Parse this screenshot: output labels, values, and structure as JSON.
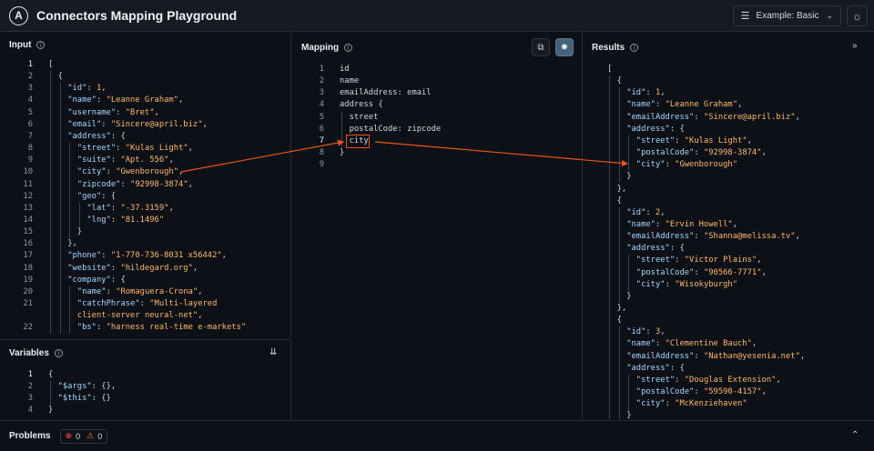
{
  "header": {
    "title": "Connectors Mapping Playground",
    "example_prefix": "Example:",
    "example_value": "Basic"
  },
  "input": {
    "title": "Input",
    "lines": [
      {
        "n": "1",
        "indent": 0,
        "parts": [
          [
            "p",
            "["
          ]
        ]
      },
      {
        "n": "2",
        "indent": 1,
        "parts": [
          [
            "p",
            "{"
          ]
        ]
      },
      {
        "n": "3",
        "indent": 2,
        "parts": [
          [
            "k",
            "\"id\""
          ],
          [
            "p",
            ": "
          ],
          [
            "n",
            "1"
          ],
          [
            "p",
            ","
          ]
        ]
      },
      {
        "n": "4",
        "indent": 2,
        "parts": [
          [
            "k",
            "\"name\""
          ],
          [
            "p",
            ": "
          ],
          [
            "s",
            "\"Leanne Graham\""
          ],
          [
            "p",
            ","
          ]
        ]
      },
      {
        "n": "5",
        "indent": 2,
        "parts": [
          [
            "k",
            "\"username\""
          ],
          [
            "p",
            ": "
          ],
          [
            "s",
            "\"Bret\""
          ],
          [
            "p",
            ","
          ]
        ]
      },
      {
        "n": "6",
        "indent": 2,
        "parts": [
          [
            "k",
            "\"email\""
          ],
          [
            "p",
            ": "
          ],
          [
            "s",
            "\"Sincere@april.biz\""
          ],
          [
            "p",
            ","
          ]
        ]
      },
      {
        "n": "7",
        "indent": 2,
        "parts": [
          [
            "k",
            "\"address\""
          ],
          [
            "p",
            ": {"
          ]
        ]
      },
      {
        "n": "8",
        "indent": 3,
        "parts": [
          [
            "k",
            "\"street\""
          ],
          [
            "p",
            ": "
          ],
          [
            "s",
            "\"Kulas Light\""
          ],
          [
            "p",
            ","
          ]
        ]
      },
      {
        "n": "9",
        "indent": 3,
        "parts": [
          [
            "k",
            "\"suite\""
          ],
          [
            "p",
            ": "
          ],
          [
            "s",
            "\"Apt. 556\""
          ],
          [
            "p",
            ","
          ]
        ]
      },
      {
        "n": "10",
        "indent": 3,
        "parts": [
          [
            "k",
            "\"city\""
          ],
          [
            "p",
            ": "
          ],
          [
            "s",
            "\"Gwenborough\""
          ],
          [
            "p",
            ","
          ]
        ]
      },
      {
        "n": "11",
        "indent": 3,
        "parts": [
          [
            "k",
            "\"zipcode\""
          ],
          [
            "p",
            ": "
          ],
          [
            "s",
            "\"92998-3874\""
          ],
          [
            "p",
            ","
          ]
        ]
      },
      {
        "n": "12",
        "indent": 3,
        "parts": [
          [
            "k",
            "\"geo\""
          ],
          [
            "p",
            ": {"
          ]
        ]
      },
      {
        "n": "13",
        "indent": 4,
        "parts": [
          [
            "k",
            "\"lat\""
          ],
          [
            "p",
            ": "
          ],
          [
            "s",
            "\"-37.3159\""
          ],
          [
            "p",
            ","
          ]
        ]
      },
      {
        "n": "14",
        "indent": 4,
        "parts": [
          [
            "k",
            "\"lng\""
          ],
          [
            "p",
            ": "
          ],
          [
            "s",
            "\"81.1496\""
          ]
        ]
      },
      {
        "n": "15",
        "indent": 3,
        "parts": [
          [
            "p",
            "}"
          ]
        ]
      },
      {
        "n": "16",
        "indent": 2,
        "parts": [
          [
            "p",
            "},"
          ]
        ]
      },
      {
        "n": "17",
        "indent": 2,
        "parts": [
          [
            "k",
            "\"phone\""
          ],
          [
            "p",
            ": "
          ],
          [
            "s",
            "\"1-770-736-8031 x56442\""
          ],
          [
            "p",
            ","
          ]
        ]
      },
      {
        "n": "18",
        "indent": 2,
        "parts": [
          [
            "k",
            "\"website\""
          ],
          [
            "p",
            ": "
          ],
          [
            "s",
            "\"hildegard.org\""
          ],
          [
            "p",
            ","
          ]
        ]
      },
      {
        "n": "19",
        "indent": 2,
        "parts": [
          [
            "k",
            "\"company\""
          ],
          [
            "p",
            ": {"
          ]
        ]
      },
      {
        "n": "20",
        "indent": 3,
        "parts": [
          [
            "k",
            "\"name\""
          ],
          [
            "p",
            ": "
          ],
          [
            "s",
            "\"Romaguera-Crona\""
          ],
          [
            "p",
            ","
          ]
        ]
      },
      {
        "n": "21",
        "indent": 3,
        "parts": [
          [
            "k",
            "\"catchPhrase\""
          ],
          [
            "p",
            ": "
          ],
          [
            "s",
            "\"Multi-layered"
          ]
        ]
      },
      {
        "n": "",
        "indent": 3,
        "parts": [
          [
            "s",
            "client-server neural-net\""
          ],
          [
            "p",
            ","
          ]
        ]
      },
      {
        "n": "22",
        "indent": 3,
        "parts": [
          [
            "k",
            "\"bs\""
          ],
          [
            "p",
            ": "
          ],
          [
            "s",
            "\"harness real-time e-markets\""
          ]
        ]
      }
    ]
  },
  "variables": {
    "title": "Variables",
    "lines": [
      {
        "n": "1",
        "indent": 0,
        "parts": [
          [
            "p",
            "{"
          ]
        ]
      },
      {
        "n": "2",
        "indent": 1,
        "parts": [
          [
            "k",
            "\"$args\""
          ],
          [
            "p",
            ": {},"
          ]
        ]
      },
      {
        "n": "3",
        "indent": 1,
        "parts": [
          [
            "k",
            "\"$this\""
          ],
          [
            "p",
            ": {}"
          ]
        ]
      },
      {
        "n": "4",
        "indent": 0,
        "parts": [
          [
            "p",
            "}"
          ]
        ]
      }
    ]
  },
  "mapping": {
    "title": "Mapping",
    "lines": [
      {
        "n": "1",
        "indent": 0,
        "parts": [
          [
            "p",
            "id"
          ]
        ]
      },
      {
        "n": "2",
        "indent": 0,
        "parts": [
          [
            "p",
            "name"
          ]
        ]
      },
      {
        "n": "3",
        "indent": 0,
        "parts": [
          [
            "p",
            "emailAddress: email"
          ]
        ]
      },
      {
        "n": "4",
        "indent": 0,
        "parts": [
          [
            "p",
            "address {"
          ]
        ]
      },
      {
        "n": "5",
        "indent": 1,
        "parts": [
          [
            "p",
            "street"
          ]
        ]
      },
      {
        "n": "6",
        "indent": 1,
        "parts": [
          [
            "p",
            "postalCode: zipcode"
          ]
        ]
      },
      {
        "n": "7",
        "indent": 1,
        "parts": [
          [
            "p",
            "city"
          ]
        ]
      },
      {
        "n": "8",
        "indent": 0,
        "parts": [
          [
            "p",
            "}"
          ]
        ]
      },
      {
        "n": "9",
        "indent": 0,
        "parts": [
          [
            "p",
            ""
          ]
        ]
      }
    ]
  },
  "results": {
    "title": "Results",
    "lines": [
      {
        "indent": 0,
        "parts": [
          [
            "p",
            "["
          ]
        ]
      },
      {
        "indent": 1,
        "parts": [
          [
            "p",
            "{"
          ]
        ]
      },
      {
        "indent": 2,
        "parts": [
          [
            "k",
            "\"id\""
          ],
          [
            "p",
            ": "
          ],
          [
            "n",
            "1"
          ],
          [
            "p",
            ","
          ]
        ]
      },
      {
        "indent": 2,
        "parts": [
          [
            "k",
            "\"name\""
          ],
          [
            "p",
            ": "
          ],
          [
            "s",
            "\"Leanne Graham\""
          ],
          [
            "p",
            ","
          ]
        ]
      },
      {
        "indent": 2,
        "parts": [
          [
            "k",
            "\"emailAddress\""
          ],
          [
            "p",
            ": "
          ],
          [
            "s",
            "\"Sincere@april.biz\""
          ],
          [
            "p",
            ","
          ]
        ]
      },
      {
        "indent": 2,
        "parts": [
          [
            "k",
            "\"address\""
          ],
          [
            "p",
            ": {"
          ]
        ]
      },
      {
        "indent": 3,
        "parts": [
          [
            "k",
            "\"street\""
          ],
          [
            "p",
            ": "
          ],
          [
            "s",
            "\"Kulas Light\""
          ],
          [
            "p",
            ","
          ]
        ]
      },
      {
        "indent": 3,
        "parts": [
          [
            "k",
            "\"postalCode\""
          ],
          [
            "p",
            ": "
          ],
          [
            "s",
            "\"92998-3874\""
          ],
          [
            "p",
            ","
          ]
        ]
      },
      {
        "indent": 3,
        "parts": [
          [
            "k",
            "\"city\""
          ],
          [
            "p",
            ": "
          ],
          [
            "s",
            "\"Gwenborough\""
          ]
        ]
      },
      {
        "indent": 2,
        "parts": [
          [
            "p",
            "}"
          ]
        ]
      },
      {
        "indent": 1,
        "parts": [
          [
            "p",
            "},"
          ]
        ]
      },
      {
        "indent": 1,
        "parts": [
          [
            "p",
            "{"
          ]
        ]
      },
      {
        "indent": 2,
        "parts": [
          [
            "k",
            "\"id\""
          ],
          [
            "p",
            ": "
          ],
          [
            "n",
            "2"
          ],
          [
            "p",
            ","
          ]
        ]
      },
      {
        "indent": 2,
        "parts": [
          [
            "k",
            "\"name\""
          ],
          [
            "p",
            ": "
          ],
          [
            "s",
            "\"Ervin Howell\""
          ],
          [
            "p",
            ","
          ]
        ]
      },
      {
        "indent": 2,
        "parts": [
          [
            "k",
            "\"emailAddress\""
          ],
          [
            "p",
            ": "
          ],
          [
            "s",
            "\"Shanna@melissa.tv\""
          ],
          [
            "p",
            ","
          ]
        ]
      },
      {
        "indent": 2,
        "parts": [
          [
            "k",
            "\"address\""
          ],
          [
            "p",
            ": {"
          ]
        ]
      },
      {
        "indent": 3,
        "parts": [
          [
            "k",
            "\"street\""
          ],
          [
            "p",
            ": "
          ],
          [
            "s",
            "\"Victor Plains\""
          ],
          [
            "p",
            ","
          ]
        ]
      },
      {
        "indent": 3,
        "parts": [
          [
            "k",
            "\"postalCode\""
          ],
          [
            "p",
            ": "
          ],
          [
            "s",
            "\"90566-7771\""
          ],
          [
            "p",
            ","
          ]
        ]
      },
      {
        "indent": 3,
        "parts": [
          [
            "k",
            "\"city\""
          ],
          [
            "p",
            ": "
          ],
          [
            "s",
            "\"Wisokyburgh\""
          ]
        ]
      },
      {
        "indent": 2,
        "parts": [
          [
            "p",
            "}"
          ]
        ]
      },
      {
        "indent": 1,
        "parts": [
          [
            "p",
            "},"
          ]
        ]
      },
      {
        "indent": 1,
        "parts": [
          [
            "p",
            "{"
          ]
        ]
      },
      {
        "indent": 2,
        "parts": [
          [
            "k",
            "\"id\""
          ],
          [
            "p",
            ": "
          ],
          [
            "n",
            "3"
          ],
          [
            "p",
            ","
          ]
        ]
      },
      {
        "indent": 2,
        "parts": [
          [
            "k",
            "\"name\""
          ],
          [
            "p",
            ": "
          ],
          [
            "s",
            "\"Clementine Bauch\""
          ],
          [
            "p",
            ","
          ]
        ]
      },
      {
        "indent": 2,
        "parts": [
          [
            "k",
            "\"emailAddress\""
          ],
          [
            "p",
            ": "
          ],
          [
            "s",
            "\"Nathan@yesenia.net\""
          ],
          [
            "p",
            ","
          ]
        ]
      },
      {
        "indent": 2,
        "parts": [
          [
            "k",
            "\"address\""
          ],
          [
            "p",
            ": {"
          ]
        ]
      },
      {
        "indent": 3,
        "parts": [
          [
            "k",
            "\"street\""
          ],
          [
            "p",
            ": "
          ],
          [
            "s",
            "\"Douglas Extension\""
          ],
          [
            "p",
            ","
          ]
        ]
      },
      {
        "indent": 3,
        "parts": [
          [
            "k",
            "\"postalCode\""
          ],
          [
            "p",
            ": "
          ],
          [
            "s",
            "\"59590-4157\""
          ],
          [
            "p",
            ","
          ]
        ]
      },
      {
        "indent": 3,
        "parts": [
          [
            "k",
            "\"city\""
          ],
          [
            "p",
            ": "
          ],
          [
            "s",
            "\"McKenziehaven\""
          ]
        ]
      },
      {
        "indent": 2,
        "parts": [
          [
            "p",
            "}"
          ]
        ]
      }
    ]
  },
  "problems": {
    "title": "Problems",
    "error_count": "0",
    "warning_count": "0"
  },
  "colors": {
    "highlight": "#e5551c",
    "key": "#a5d6ff",
    "string": "#ffb86c"
  },
  "icons": [
    "settings-icon",
    "theme-icon",
    "copy-icon",
    "visualize-icon",
    "expand-icon",
    "collapse-icon",
    "info-icon"
  ]
}
